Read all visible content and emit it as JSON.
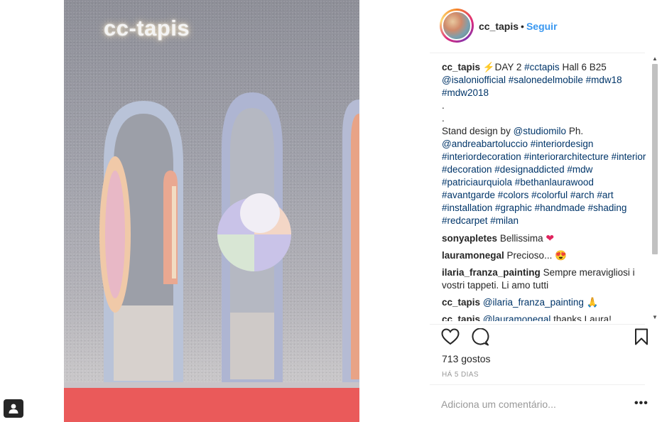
{
  "post": {
    "account": "cc_tapis",
    "follow_separator": "•",
    "follow_label": "Seguir",
    "image_logo_text": "cc-tapis"
  },
  "caption": {
    "user": "cc_tapis",
    "emoji": "⚡",
    "text_1": "DAY 2 ",
    "tag_cctapis": "#cctapis",
    "text_2": " Hall 6 B25 ",
    "tags_line2": "@isaloniofficial #salonedelmobile #mdw18 #mdw2018",
    "dots": ".",
    "text_3": "Stand design by ",
    "tag_studio": "@studiomilo",
    "text_4": " Ph. ",
    "tags_rest": "@andreabartoluccio #interiordesign #interiordecoration #interiorarchitecture #interior #decoration #designaddicted #mdw #patriciaurquiola #bethanlaurawood #avantgarde #colors #colorful #arch #art #installation #graphic #handmade #shading #redcarpet #milan"
  },
  "comments": [
    {
      "user": "sonyapletes",
      "text": "Bellissima",
      "emoji": "❤"
    },
    {
      "user": "lauramonegal",
      "text": "Precioso...",
      "emoji": "😍"
    },
    {
      "user": "ilaria_franza_painting",
      "text": "Sempre meravigliosi i vostri tappeti. Li amo tutti",
      "emoji": ""
    },
    {
      "user": "cc_tapis",
      "tag": "@ilaria_franza_painting",
      "text": "",
      "emoji": "🙏"
    },
    {
      "user": "cc_tapis",
      "tag": "@lauramonegal",
      "text": " thanks Laura!",
      "emoji": ""
    }
  ],
  "stats": {
    "likes": "713 gostos",
    "time_ago": "HÁ 5 DIAS"
  },
  "comment_form": {
    "placeholder": "Adiciona um comentário...",
    "more_label": "•••"
  },
  "colors": {
    "link": "#3897f0",
    "tag": "#003569",
    "floor": "#ea5a5a"
  },
  "icons": [
    "heart-icon",
    "comment-icon",
    "bookmark-icon",
    "user-icon",
    "scroll-up-icon",
    "scroll-down-icon"
  ]
}
